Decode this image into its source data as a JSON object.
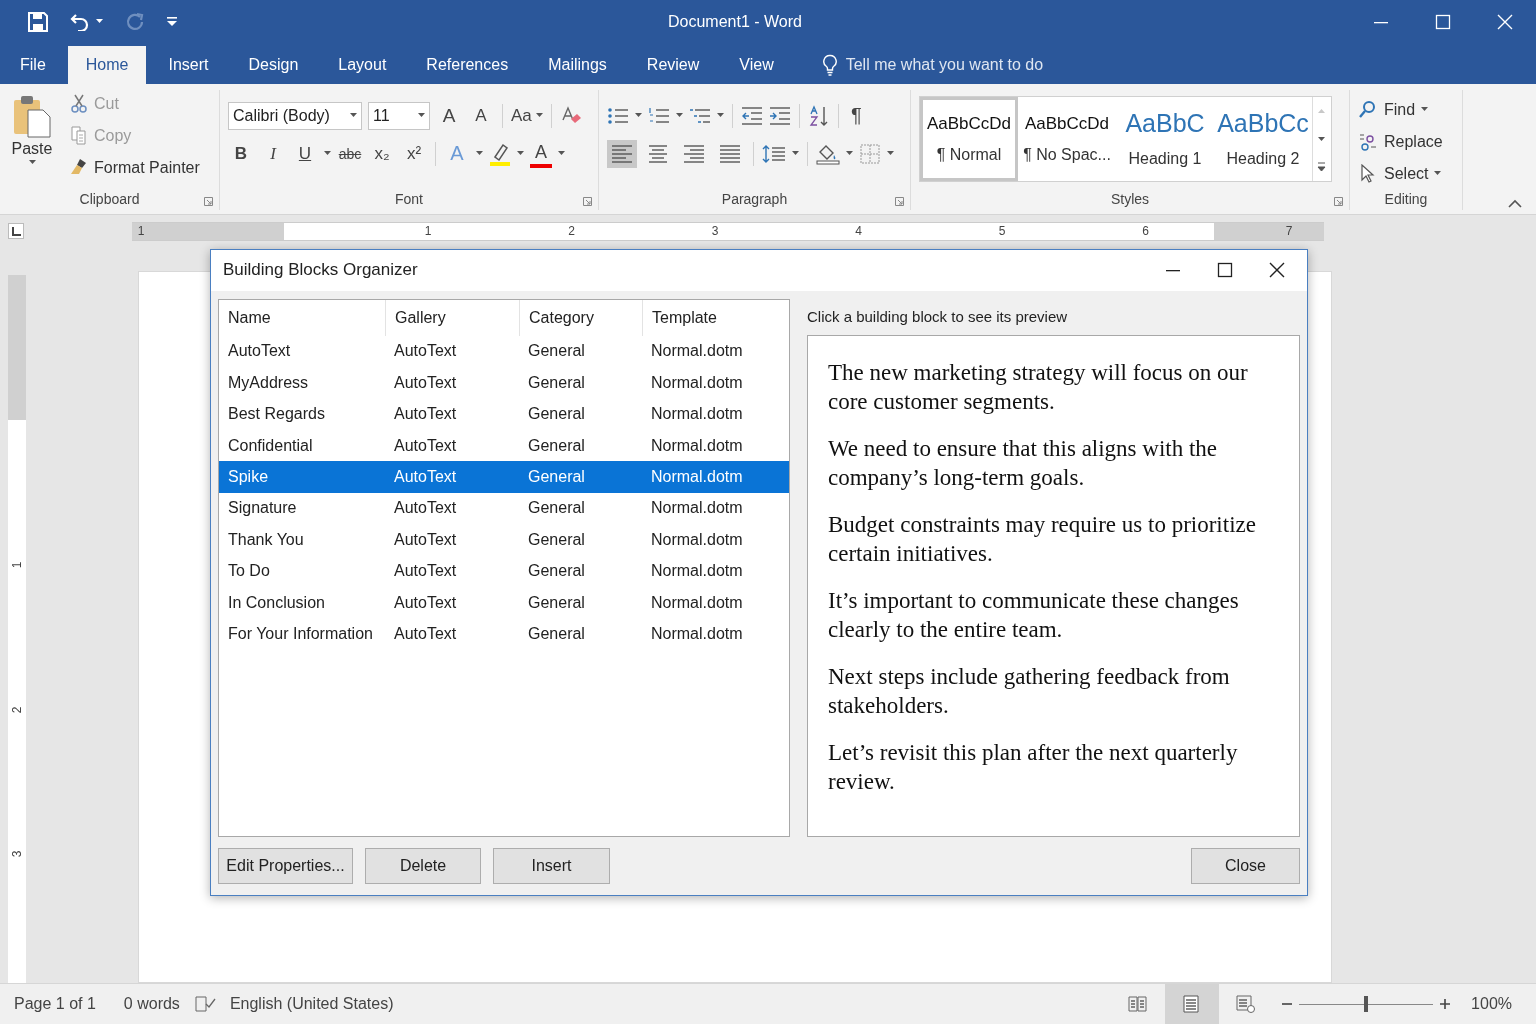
{
  "window": {
    "title": "Document1 - Word"
  },
  "tabs": [
    {
      "label": "File",
      "selected": false
    },
    {
      "label": "Home",
      "selected": true
    },
    {
      "label": "Insert",
      "selected": false
    },
    {
      "label": "Design",
      "selected": false
    },
    {
      "label": "Layout",
      "selected": false
    },
    {
      "label": "References",
      "selected": false
    },
    {
      "label": "Mailings",
      "selected": false
    },
    {
      "label": "Review",
      "selected": false
    },
    {
      "label": "View",
      "selected": false
    }
  ],
  "tell_me": {
    "placeholder": "Tell me what you want to do"
  },
  "ribbon": {
    "clipboard": {
      "label": "Clipboard",
      "paste": "Paste",
      "items": [
        {
          "label": "Cut",
          "kind": "cut",
          "disabled": true
        },
        {
          "label": "Copy",
          "kind": "copy",
          "disabled": true
        },
        {
          "label": "Format Painter",
          "kind": "painter",
          "disabled": false
        }
      ]
    },
    "font": {
      "label": "Font",
      "font_name": "Calibri (Body)",
      "font_size": "11",
      "grow_font": "A",
      "shrink_font": "A",
      "change_case": "Aa",
      "format_buttons": [
        "B",
        "I",
        "U",
        "abc",
        "x₂",
        "x²"
      ],
      "text_effects": "A",
      "font_color": "A"
    },
    "paragraph": {
      "label": "Paragraph",
      "show_marks": "¶",
      "alignments": [
        {
          "kind": "left",
          "selected": true
        },
        {
          "kind": "center",
          "selected": false
        },
        {
          "kind": "right",
          "selected": false
        },
        {
          "kind": "justify",
          "selected": false
        }
      ]
    },
    "styles": {
      "label": "Styles",
      "items": [
        {
          "sample": "AaBbCcDd",
          "name": "¶ Normal",
          "kind": "body",
          "selected": true
        },
        {
          "sample": "AaBbCcDd",
          "name": "¶ No Spac...",
          "kind": "body",
          "selected": false
        },
        {
          "sample": "AaBbC",
          "name": "Heading 1",
          "kind": "heading",
          "selected": false
        },
        {
          "sample": "AaBbCc",
          "name": "Heading 2",
          "kind": "heading",
          "selected": false
        }
      ]
    },
    "editing": {
      "label": "Editing",
      "items": [
        {
          "label": "Find",
          "kind": "find"
        },
        {
          "label": "Replace",
          "kind": "replace"
        },
        {
          "label": "Select",
          "kind": "select"
        }
      ]
    }
  },
  "ruler": {
    "labels": [
      "1",
      "1",
      "2",
      "3",
      "4",
      "5",
      "6",
      "7"
    ]
  },
  "vertical_ruler": {
    "labels": [
      "1",
      "2",
      "3"
    ]
  },
  "dialog": {
    "title": "Building Blocks Organizer",
    "columns": [
      "Name",
      "Gallery",
      "Category",
      "Template"
    ],
    "rows": [
      {
        "cells": [
          "AutoText",
          "AutoText",
          "General",
          "Normal.dotm"
        ],
        "selected": false
      },
      {
        "cells": [
          "MyAddress",
          "AutoText",
          "General",
          "Normal.dotm"
        ],
        "selected": false
      },
      {
        "cells": [
          "Best Regards",
          "AutoText",
          "General",
          "Normal.dotm"
        ],
        "selected": false
      },
      {
        "cells": [
          "Confidential",
          "AutoText",
          "General",
          "Normal.dotm"
        ],
        "selected": false
      },
      {
        "cells": [
          "Spike",
          "AutoText",
          "General",
          "Normal.dotm"
        ],
        "selected": true
      },
      {
        "cells": [
          "Signature",
          "AutoText",
          "General",
          "Normal.dotm"
        ],
        "selected": false
      },
      {
        "cells": [
          "Thank You",
          "AutoText",
          "General",
          "Normal.dotm"
        ],
        "selected": false
      },
      {
        "cells": [
          "To Do",
          "AutoText",
          "General",
          "Normal.dotm"
        ],
        "selected": false
      },
      {
        "cells": [
          "In Conclusion",
          "AutoText",
          "General",
          "Normal.dotm"
        ],
        "selected": false
      },
      {
        "cells": [
          "For Your Information",
          "AutoText",
          "General",
          "Normal.dotm"
        ],
        "selected": false
      }
    ],
    "preview_label": "Click a building block to see its preview",
    "preview_paragraphs": [
      "The new marketing strategy will focus on our core customer segments.",
      "We need to ensure that this aligns with the company’s long-term goals.",
      "Budget constraints may require us to prioritize certain initiatives.",
      "It’s important to communicate these changes clearly to the entire team.",
      "Next steps include gathering feedback from stakeholders.",
      "Let’s revisit this plan after the next quarterly review."
    ],
    "buttons": [
      "Edit Properties...",
      "Delete",
      "Insert"
    ],
    "close_button": "Close"
  },
  "status_bar": {
    "page": "Page 1 of 1",
    "words": "0 words",
    "language": "English (United States)",
    "views": [
      {
        "kind": "read",
        "selected": false
      },
      {
        "kind": "print",
        "selected": true
      },
      {
        "kind": "web",
        "selected": false
      }
    ],
    "zoom": {
      "level": 0.5,
      "reading": "100%"
    }
  }
}
